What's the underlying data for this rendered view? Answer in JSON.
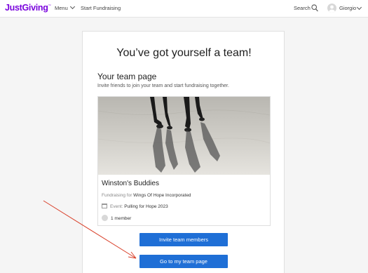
{
  "nav": {
    "logo": "JustGiving",
    "logo_mark": "™",
    "menu_label": "Menu",
    "start_fundraising": "Start Fundraising",
    "search_label": "Search",
    "user_name": "Giorgio"
  },
  "page": {
    "headline": "You’ve got yourself a team!",
    "section_title": "Your team page",
    "section_subtitle": "Invite friends to join your team and start fundraising together."
  },
  "team": {
    "name": "Winston's Buddies",
    "fundraising_prefix": "Fundraising for",
    "charity": "Wings Of Hope Incorporated",
    "event_prefix": "Event:",
    "event_name": "Pulling for Hope 2023",
    "members": "1 member"
  },
  "buttons": {
    "invite": "Invite team members",
    "goto": "Go to my team page"
  },
  "colors": {
    "brand": "#7a04dd",
    "button": "#1f6fd6",
    "annotation_arrow": "#d9402a"
  }
}
